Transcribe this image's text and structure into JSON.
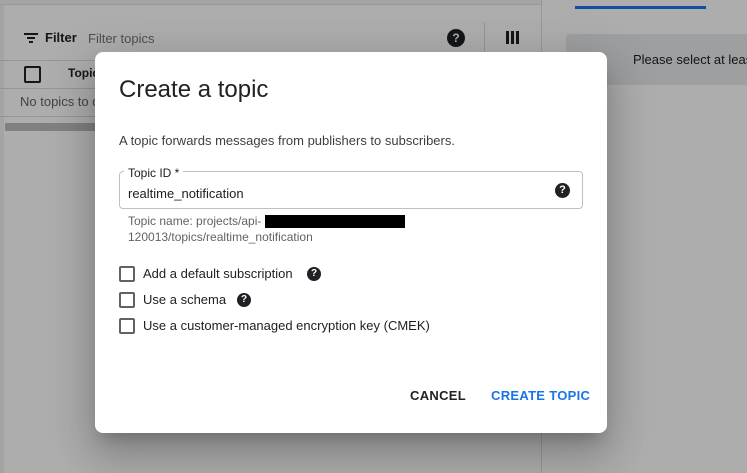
{
  "toolbar": {
    "filter_label": "Filter",
    "filter_placeholder": "Filter topics",
    "help_glyph": "?"
  },
  "table": {
    "column_topic": "Topic",
    "empty_text": "No topics to d"
  },
  "right_panel": {
    "info_text": "Please select at leas"
  },
  "dialog": {
    "title": "Create a topic",
    "description": "A topic forwards messages from publishers to subscribers.",
    "topic_id_label": "Topic ID *",
    "topic_id_value": "realtime_notification",
    "help_glyph": "?",
    "topic_name_prefix": "Topic name: projects/api-",
    "topic_name_suffix": "120013/topics/realtime_notification",
    "options": [
      {
        "label": "Add a default subscription",
        "checked": false,
        "has_help": true
      },
      {
        "label": "Use a schema",
        "checked": false,
        "has_help": true
      },
      {
        "label": "Use a customer-managed encryption key (CMEK)",
        "checked": false,
        "has_help": false
      }
    ],
    "cancel_label": "CANCEL",
    "create_label": "CREATE TOPIC"
  },
  "colors": {
    "accent": "#1a73e8",
    "text": "#202124",
    "secondary_text": "#5f6368",
    "overlay": "rgba(0,0,0,0.32)"
  },
  "icons": [
    "filter-icon",
    "help-icon",
    "columns-icon",
    "checkbox-icon"
  ]
}
